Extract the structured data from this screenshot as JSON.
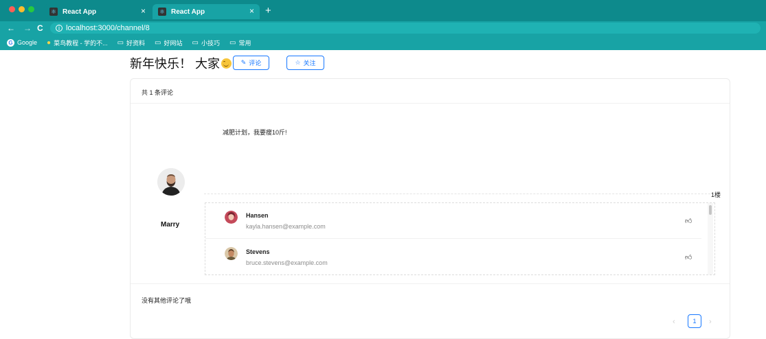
{
  "browser": {
    "tabs": [
      {
        "title": "React App",
        "close": "×"
      },
      {
        "title": "React App",
        "close": "×"
      }
    ],
    "new_tab": "+",
    "nav": {
      "back": "←",
      "forward": "→",
      "reload": "C"
    },
    "url": "localhost:3000/channel/8",
    "bookmarks": [
      {
        "label": "Google",
        "icon": "google-icon"
      },
      {
        "label": "菜鸟教程 - 学的不...",
        "icon": "runoob-icon"
      },
      {
        "label": "好资料",
        "icon": "folder-icon"
      },
      {
        "label": "好网站",
        "icon": "folder-icon"
      },
      {
        "label": "小技巧",
        "icon": "folder-icon"
      },
      {
        "label": "常用",
        "icon": "folder-icon"
      }
    ]
  },
  "header": {
    "title": "新年快乐！ 大家",
    "comment_button": "评论",
    "follow_button": "关注"
  },
  "card": {
    "count_text": "共 1 条评论",
    "author": "Marry",
    "comment": "减肥计划，我要瘦10斤!",
    "floor": "1楼",
    "replies": [
      {
        "name": "Hansen",
        "email": "kayla.hansen@example.com"
      },
      {
        "name": "Stevens",
        "email": "bruce.stevens@example.com"
      }
    ],
    "no_more": "没有其他评论了哦"
  },
  "pagination": {
    "prev": "‹",
    "current": "1",
    "next": "›"
  },
  "colors": {
    "chrome": "#0d8a8c",
    "chrome_light": "#18a3a5",
    "accent": "#1677ff"
  }
}
